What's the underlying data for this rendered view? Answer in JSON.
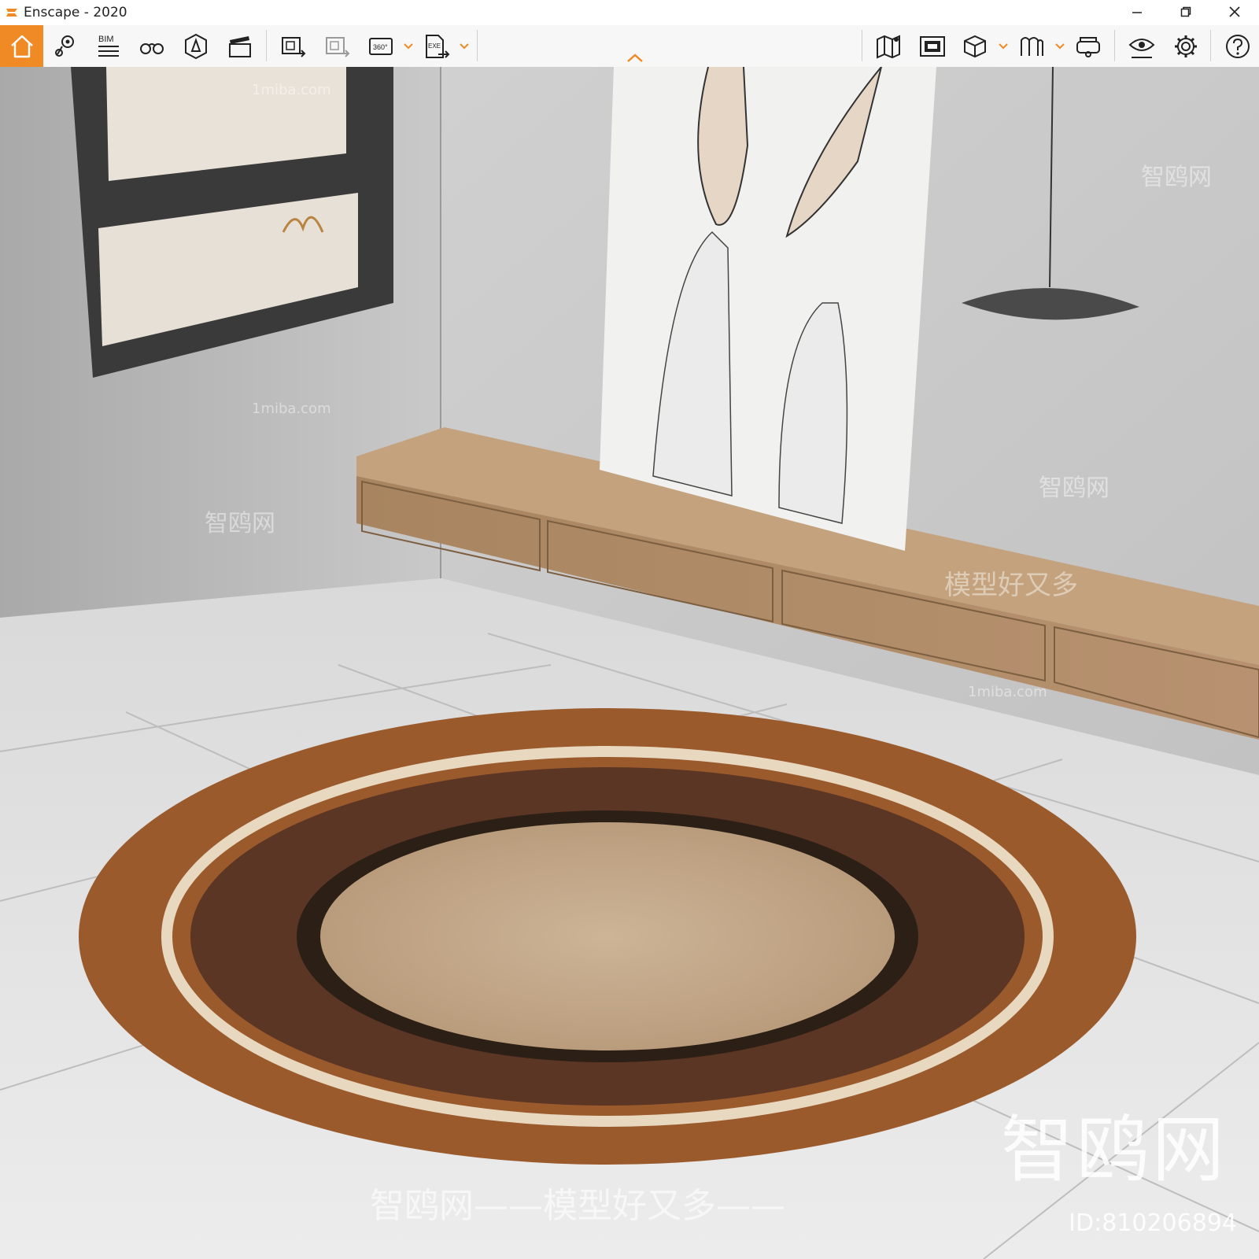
{
  "window": {
    "title": "Enscape - 2020",
    "controls": [
      "minimize-icon",
      "restore-icon",
      "close-icon"
    ]
  },
  "toolbar": {
    "accent_color": "#f08a24",
    "left_tools": [
      "home-icon",
      "location-pin-icon",
      "bim-icon",
      "binoculars-icon",
      "sun-icon",
      "clapper-icon",
      "batch-render-icon",
      "batch-render-disabled-icon",
      "panorama-360-icon",
      "export-exe-icon"
    ],
    "bim_label": "BIM",
    "pano_label": "360°",
    "exe_label": "EXE",
    "right_tools": [
      "map-icon",
      "screenshot-icon",
      "cube-icon",
      "views-icon",
      "vr-headset-icon",
      "eye-settings-icon",
      "gear-icon",
      "help-icon"
    ]
  },
  "viewport": {
    "watermark_big": "智鸥网",
    "watermark_id": "ID:810206894",
    "watermark_bottom": "智鸥网——模型好又多——",
    "watermark_small": [
      "1miba.com",
      "智鸥网",
      "1miba.com",
      "智鸥网",
      "1miba.com",
      "智鸥网",
      "模型好又多"
    ]
  }
}
